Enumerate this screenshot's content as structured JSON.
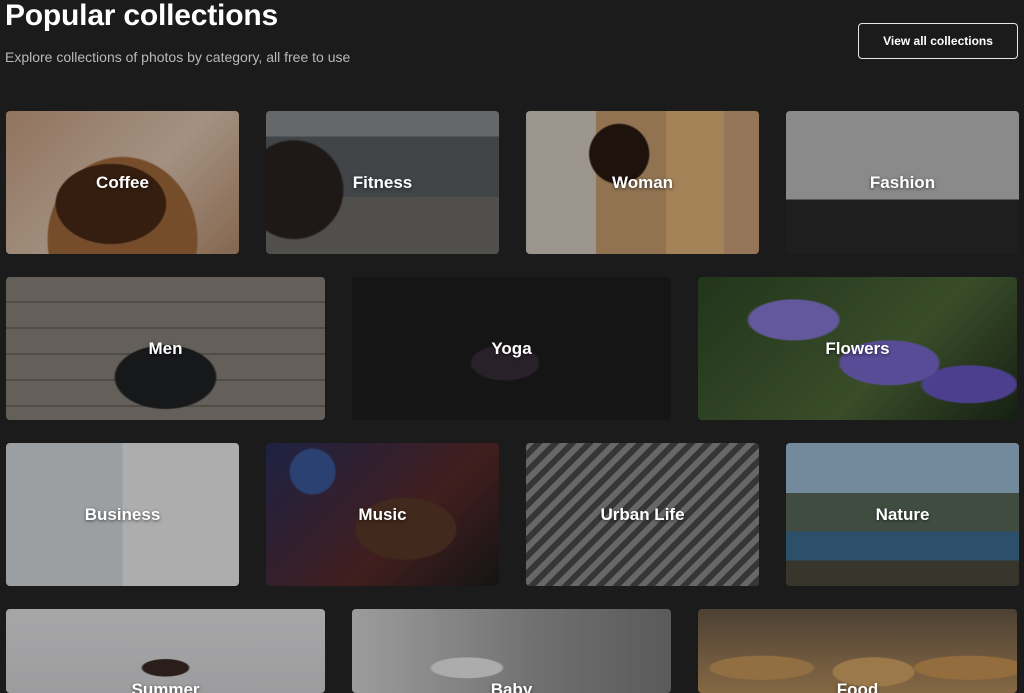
{
  "header": {
    "title": "Popular collections",
    "subtitle": "Explore collections of photos by category, all free to use",
    "view_all_label": "View all collections"
  },
  "collections": [
    {
      "label": "Coffee"
    },
    {
      "label": "Fitness"
    },
    {
      "label": "Woman"
    },
    {
      "label": "Fashion"
    },
    {
      "label": "Men"
    },
    {
      "label": "Yoga"
    },
    {
      "label": "Flowers"
    },
    {
      "label": "Business"
    },
    {
      "label": "Music"
    },
    {
      "label": "Urban Life"
    },
    {
      "label": "Nature"
    },
    {
      "label": "Summer"
    },
    {
      "label": "Baby"
    },
    {
      "label": "Food"
    }
  ]
}
